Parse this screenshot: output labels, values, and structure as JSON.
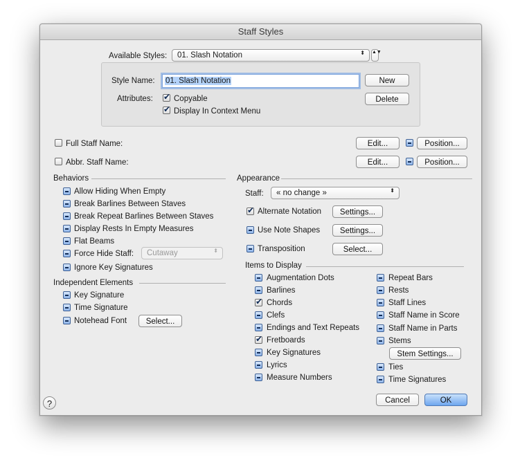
{
  "window": {
    "title": "Staff Styles"
  },
  "styles": {
    "available_label": "Available Styles:",
    "selected": "01.  Slash Notation",
    "stepper_glyph": "▲▼",
    "arrows_glyph": "⬍"
  },
  "style_box": {
    "name_label": "Style Name:",
    "name_value": "01.  Slash Notation",
    "new_button": "New",
    "delete_button": "Delete",
    "attributes_label": "Attributes:",
    "copyable": "Copyable",
    "display_context": "Display In Context Menu"
  },
  "names": {
    "full_label": "Full Staff Name:",
    "abbr_label": "Abbr. Staff Name:",
    "edit_button": "Edit...",
    "position_button": "Position..."
  },
  "behaviors": {
    "title": "Behaviors",
    "items": [
      "Allow Hiding When Empty",
      "Break Barlines Between Staves",
      "Break Repeat Barlines Between Staves",
      "Display Rests In Empty Measures",
      "Flat Beams",
      "Force Hide Staff:",
      "Ignore Key Signatures"
    ],
    "force_hide_value": "Cutaway"
  },
  "independent": {
    "title": "Independent Elements",
    "items": [
      "Key Signature",
      "Time Signature",
      "Notehead Font"
    ],
    "select_button": "Select..."
  },
  "appearance": {
    "title": "Appearance",
    "staff_label": "Staff:",
    "staff_value": "« no change »",
    "alternate_notation": "Alternate Notation",
    "use_note_shapes": "Use Note Shapes",
    "transposition": "Transposition",
    "settings_button": "Settings...",
    "select_button": "Select..."
  },
  "items_display": {
    "title": "Items to Display",
    "left": [
      "Augmentation Dots",
      "Barlines",
      "Chords",
      "Clefs",
      "Endings and Text Repeats",
      "Fretboards",
      "Key Signatures",
      "Lyrics",
      "Measure Numbers"
    ],
    "right": [
      "Repeat Bars",
      "Rests",
      "Staff Lines",
      "Staff Name in Score",
      "Staff Name in Parts",
      "Stems"
    ],
    "stem_settings_button": "Stem Settings...",
    "right_bottom": [
      "Ties",
      "Time Signatures"
    ]
  },
  "footer": {
    "help": "?",
    "cancel": "Cancel",
    "ok": "OK"
  }
}
